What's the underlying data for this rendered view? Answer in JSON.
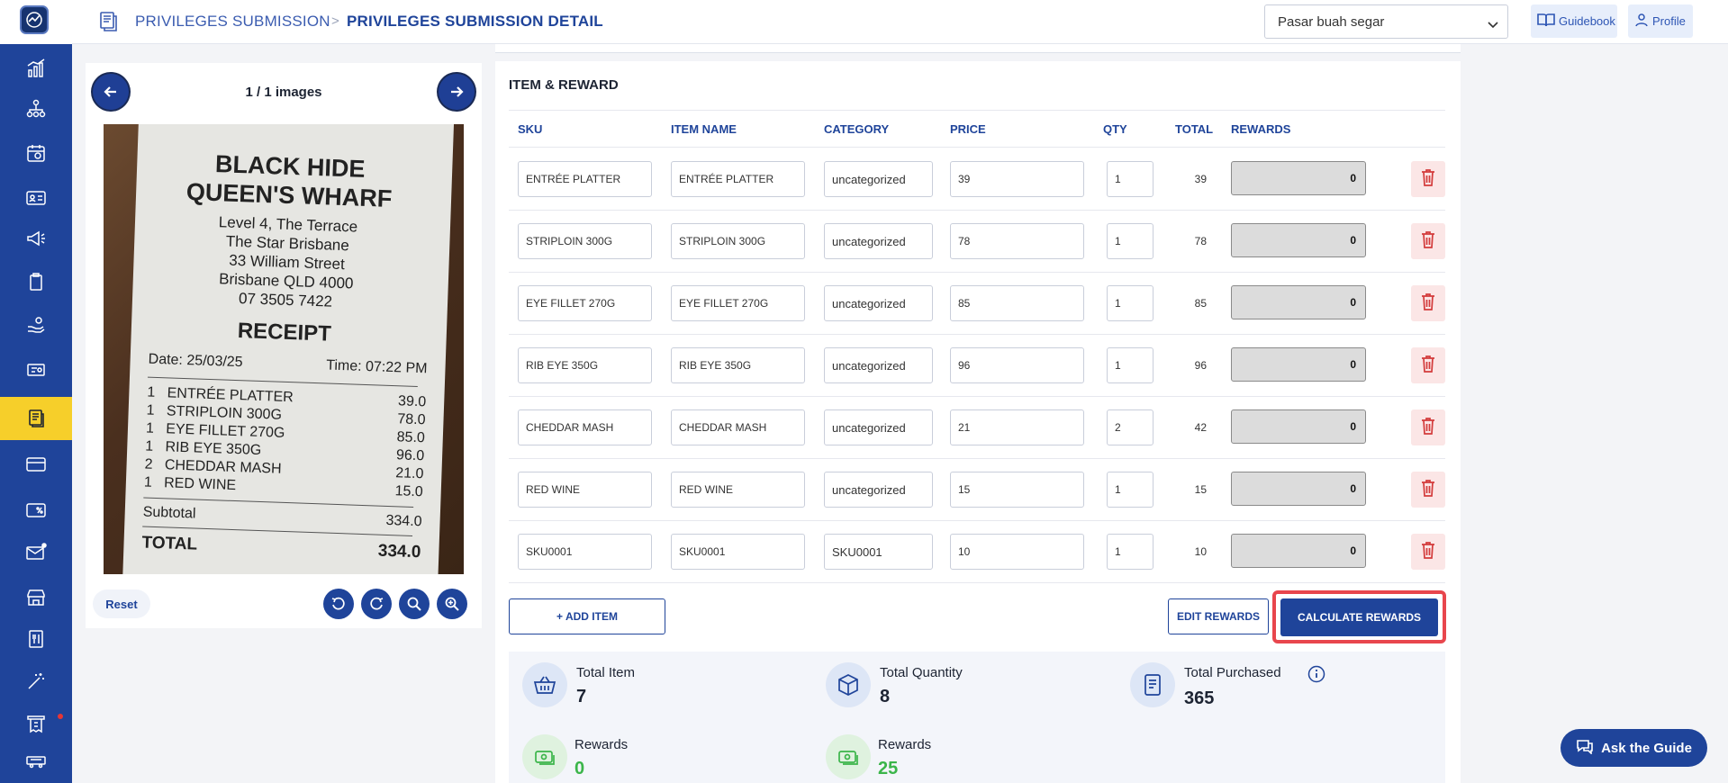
{
  "header": {
    "breadcrumb_parent": "PRIVILEGES SUBMISSION",
    "breadcrumb_separator": ">",
    "breadcrumb_current": "PRIVILEGES SUBMISSION DETAIL",
    "store_select_value": "Pasar buah segar",
    "guidebook_label": "Guidebook",
    "profile_label": "Profile"
  },
  "sidebar": {
    "items": [
      {
        "icon": "chart-icon"
      },
      {
        "icon": "org-chart-icon"
      },
      {
        "icon": "calendar-icon"
      },
      {
        "icon": "id-card-icon"
      },
      {
        "icon": "megaphone-icon"
      },
      {
        "icon": "clipboard-icon"
      },
      {
        "icon": "hand-coin-icon"
      },
      {
        "icon": "ticket-icon"
      },
      {
        "icon": "document-icon",
        "active": true
      },
      {
        "icon": "card-icon"
      },
      {
        "icon": "discount-card-icon"
      },
      {
        "icon": "mail-icon"
      },
      {
        "icon": "store-icon"
      },
      {
        "icon": "menu-book-icon"
      },
      {
        "icon": "magic-wand-icon"
      },
      {
        "icon": "receipt-icon"
      },
      {
        "icon": "truck-icon"
      }
    ]
  },
  "image_viewer": {
    "counter": "1 / 1 images",
    "reset_label": "Reset",
    "receipt": {
      "title_line1": "BLACK HIDE",
      "title_line2": "QUEEN'S WHARF",
      "address": [
        "Level 4, The Terrace",
        "The Star Brisbane",
        "33 William Street",
        "Brisbane QLD 4000",
        "07 3505 7422"
      ],
      "heading": "RECEIPT",
      "date": "Date: 25/03/25",
      "time": "Time: 07:22 PM",
      "lines": [
        {
          "qty": "1",
          "name": "ENTRÉE PLATTER",
          "amount": "39.0"
        },
        {
          "qty": "1",
          "name": "STRIPLOIN 300G",
          "amount": "78.0"
        },
        {
          "qty": "1",
          "name": "EYE FILLET 270G",
          "amount": "85.0"
        },
        {
          "qty": "1",
          "name": "RIB EYE 350G",
          "amount": "96.0"
        },
        {
          "qty": "2",
          "name": "CHEDDAR MASH",
          "amount": "21.0"
        },
        {
          "qty": "1",
          "name": "RED WINE",
          "amount": "15.0"
        }
      ],
      "subtotal_label": "Subtotal",
      "subtotal_value": "334.0",
      "total_label": "TOTAL",
      "total_value": "334.0"
    }
  },
  "items_section": {
    "title": "ITEM & REWARD",
    "columns": [
      "SKU",
      "ITEM NAME",
      "CATEGORY",
      "PRICE",
      "QTY",
      "TOTAL",
      "REWARDS"
    ],
    "rows": [
      {
        "sku": "ENTRÉE PLATTER",
        "name": "ENTRÉE PLATTER",
        "category": "uncategorized",
        "price": "39",
        "qty": "1",
        "total": "39",
        "reward": "0"
      },
      {
        "sku": "STRIPLOIN 300G",
        "name": "STRIPLOIN 300G",
        "category": "uncategorized",
        "price": "78",
        "qty": "1",
        "total": "78",
        "reward": "0"
      },
      {
        "sku": "EYE FILLET 270G",
        "name": "EYE FILLET 270G",
        "category": "uncategorized",
        "price": "85",
        "qty": "1",
        "total": "85",
        "reward": "0"
      },
      {
        "sku": "RIB EYE 350G",
        "name": "RIB EYE 350G",
        "category": "uncategorized",
        "price": "96",
        "qty": "1",
        "total": "96",
        "reward": "0"
      },
      {
        "sku": "CHEDDAR MASH",
        "name": "CHEDDAR MASH",
        "category": "uncategorized",
        "price": "21",
        "qty": "2",
        "total": "42",
        "reward": "0"
      },
      {
        "sku": "RED WINE",
        "name": "RED WINE",
        "category": "uncategorized",
        "price": "15",
        "qty": "1",
        "total": "15",
        "reward": "0"
      },
      {
        "sku": "SKU0001",
        "name": "SKU0001",
        "category": "SKU0001",
        "price": "10",
        "qty": "1",
        "total": "10",
        "reward": "0"
      }
    ],
    "add_item_label": "+ ADD ITEM",
    "edit_rewards_label": "EDIT REWARDS",
    "calculate_rewards_label": "CALCULATE REWARDS"
  },
  "summary": {
    "total_item_label": "Total Item",
    "total_item_value": "7",
    "total_quantity_label": "Total Quantity",
    "total_quantity_value": "8",
    "total_purchased_label": "Total Purchased",
    "total_purchased_value": "365",
    "rewards1_label": "Rewards",
    "rewards1_value": "0",
    "rewards2_label": "Rewards",
    "rewards2_value": "25"
  },
  "ask_guide_label": "Ask the Guide",
  "colors": {
    "primary": "#1f449a",
    "active_nav": "#f6cf2a",
    "highlight": "#e8464d",
    "reward_green": "#3bb54a"
  }
}
